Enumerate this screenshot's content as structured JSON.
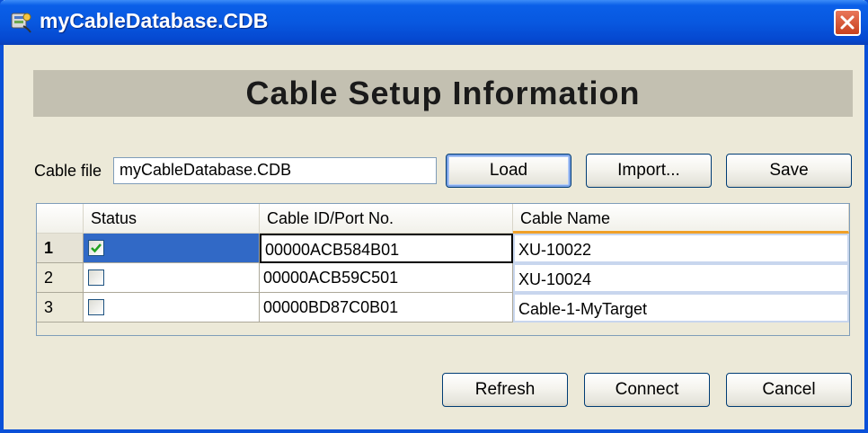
{
  "window": {
    "title": "myCableDatabase.CDB"
  },
  "header": {
    "title": "Cable Setup Information"
  },
  "cable_file": {
    "label": "Cable file",
    "value": "myCableDatabase.CDB"
  },
  "buttons": {
    "load": "Load",
    "import": "Import...",
    "save": "Save",
    "refresh": "Refresh",
    "connect": "Connect",
    "cancel": "Cancel"
  },
  "grid": {
    "columns": [
      "Status",
      "Cable ID/Port No.",
      "Cable Name"
    ],
    "rows": [
      {
        "num": "1",
        "checked": true,
        "cable_id": "00000ACB584B01",
        "name": "XU-10022"
      },
      {
        "num": "2",
        "checked": false,
        "cable_id": "00000ACB59C501",
        "name": "XU-10024"
      },
      {
        "num": "3",
        "checked": false,
        "cable_id": "00000BD87C0B01",
        "name": "Cable-1-MyTarget"
      }
    ]
  },
  "colors": {
    "titlebar": "#0858e0",
    "selection": "#3169c6",
    "close": "#c8401e",
    "header_band": "#c3c0b1"
  },
  "icons": {
    "app": "cable-database-icon",
    "close": "close-icon",
    "check": "checkmark-icon"
  }
}
